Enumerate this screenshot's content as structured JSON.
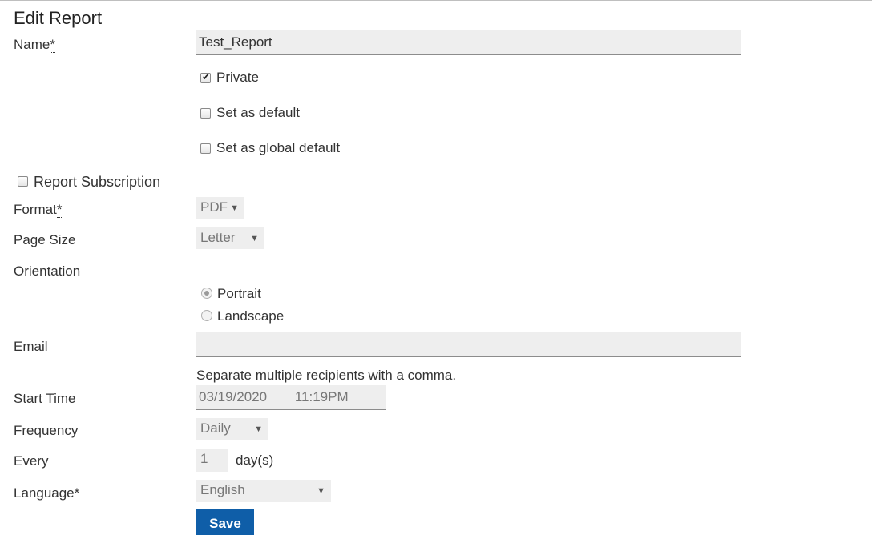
{
  "page": {
    "title": "Edit Report"
  },
  "name": {
    "label": "Name",
    "required_mark": "*",
    "value": "Test_Report"
  },
  "options": {
    "private": {
      "label": "Private",
      "checked": true
    },
    "set_default": {
      "label": "Set as default",
      "checked": false
    },
    "set_global_default": {
      "label": "Set as global default",
      "checked": false
    }
  },
  "subscription": {
    "label": "Report Subscription",
    "checked": false
  },
  "format": {
    "label": "Format",
    "required_mark": "*",
    "value": "PDF"
  },
  "page_size": {
    "label": "Page Size",
    "value": "Letter"
  },
  "orientation": {
    "label": "Orientation",
    "portrait": {
      "label": "Portrait",
      "selected": true
    },
    "landscape": {
      "label": "Landscape",
      "selected": false
    }
  },
  "email": {
    "label": "Email",
    "value": "",
    "help": "Separate multiple recipients with a comma."
  },
  "start_time": {
    "label": "Start Time",
    "date": "03/19/2020",
    "time": "11:19PM"
  },
  "frequency": {
    "label": "Frequency",
    "value": "Daily"
  },
  "every": {
    "label": "Every",
    "value": "1",
    "unit": "day(s)"
  },
  "language": {
    "label": "Language",
    "required_mark": "*",
    "value": "English"
  },
  "actions": {
    "save_label": "Save"
  },
  "icons": {
    "checkbox_check": "check-icon",
    "dropdown_caret": "caret-down-icon"
  },
  "colors": {
    "primary_button": "#0f5ea8",
    "field_background": "#eeeeee"
  }
}
